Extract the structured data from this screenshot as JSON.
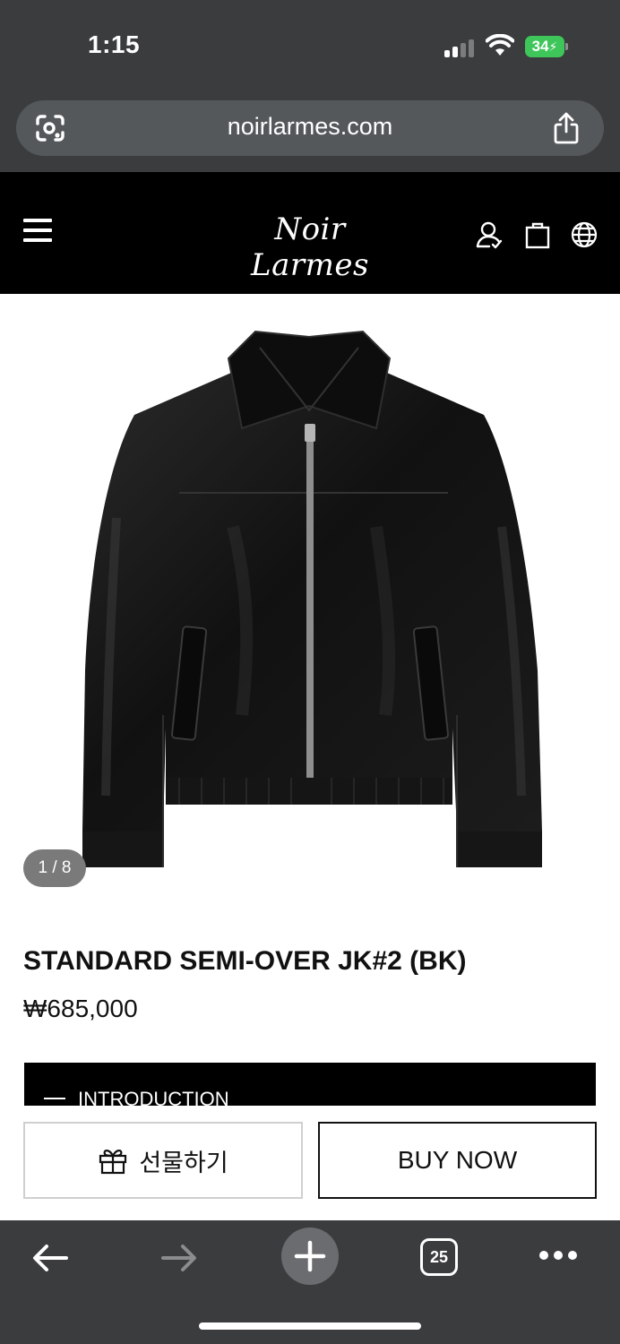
{
  "status": {
    "time": "1:15",
    "battery": "34"
  },
  "browser": {
    "url": "noirlarmes.com",
    "tab_count": "25"
  },
  "site": {
    "logo": "Noir Larmes"
  },
  "product": {
    "image_counter": "1 / 8",
    "title": "STANDARD SEMI-OVER JK#2 (BK)",
    "price": "₩685,000",
    "section_label": "INTRODUCTION"
  },
  "actions": {
    "gift_label": "선물하기",
    "buy_label": "BUY NOW"
  },
  "icons": {
    "header": [
      "menu-icon",
      "account-icon",
      "bag-icon",
      "globe-icon"
    ],
    "browser": [
      "visual-search-icon",
      "share-icon",
      "back-arrow-icon",
      "forward-arrow-icon",
      "plus-icon",
      "tabs-icon",
      "more-icon"
    ],
    "gift": "gift-icon"
  },
  "colors": {
    "header_bg": "#000000",
    "browser_chrome": "#3a3c3e",
    "battery_green": "#3fc65a",
    "counter_badge": "#7a7a7a"
  }
}
